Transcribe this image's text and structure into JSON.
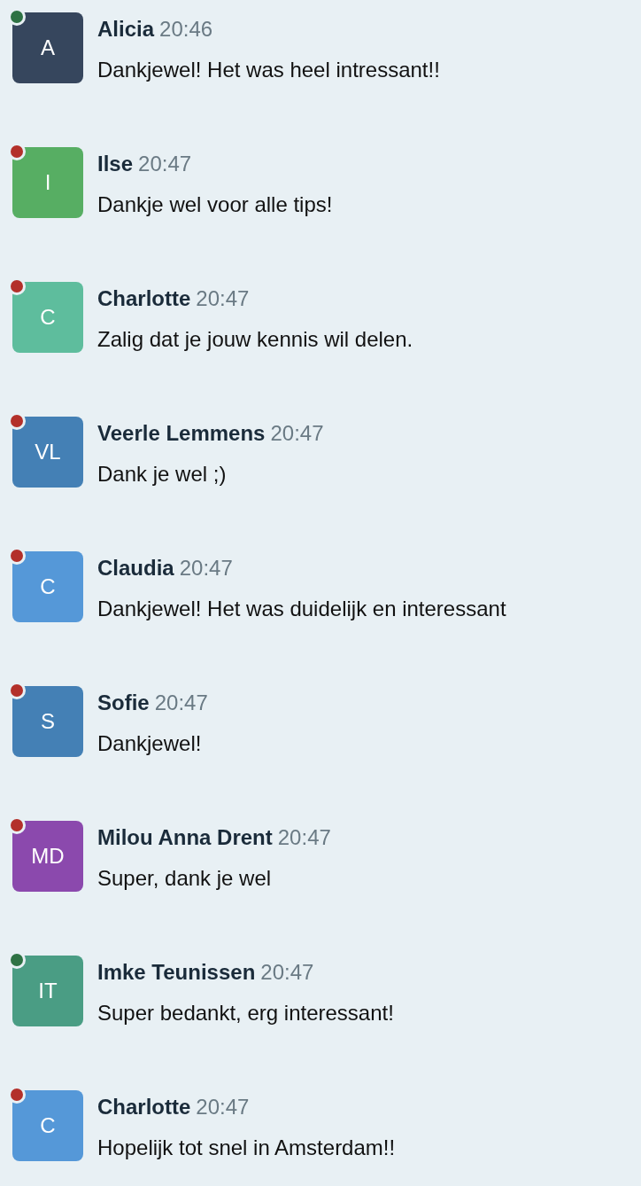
{
  "messages": [
    {
      "initials": "A",
      "color": "#36465d",
      "online": true,
      "name": "Alicia",
      "time": "20:46",
      "text": "Dankjewel! Het was heel intressant!!"
    },
    {
      "initials": "I",
      "color": "#57ae63",
      "online": false,
      "name": "Ilse",
      "time": "20:47",
      "text": "Dankje wel voor alle tips!"
    },
    {
      "initials": "C",
      "color": "#5ebd9d",
      "online": false,
      "name": "Charlotte",
      "time": "20:47",
      "text": "Zalig dat je jouw kennis wil delen."
    },
    {
      "initials": "VL",
      "color": "#4480b5",
      "online": false,
      "name": "Veerle Lemmens",
      "time": "20:47",
      "text": "Dank je wel ;)"
    },
    {
      "initials": "C",
      "color": "#5598d8",
      "online": false,
      "name": "Claudia",
      "time": "20:47",
      "text": "Dankjewel! Het was duidelijk en interessant"
    },
    {
      "initials": "S",
      "color": "#4480b5",
      "online": false,
      "name": "Sofie",
      "time": "20:47",
      "text": "Dankjewel!"
    },
    {
      "initials": "MD",
      "color": "#8b49ad",
      "online": false,
      "name": "Milou Anna Drent",
      "time": "20:47",
      "text": "Super, dank je wel"
    },
    {
      "initials": "IT",
      "color": "#4a9d84",
      "online": true,
      "name": "Imke Teunissen",
      "time": "20:47",
      "text": "Super bedankt, erg interessant!"
    },
    {
      "initials": "C",
      "color": "#5598d8",
      "online": false,
      "name": "Charlotte",
      "time": "20:47",
      "text": "Hopelijk tot snel in Amsterdam!!"
    }
  ]
}
